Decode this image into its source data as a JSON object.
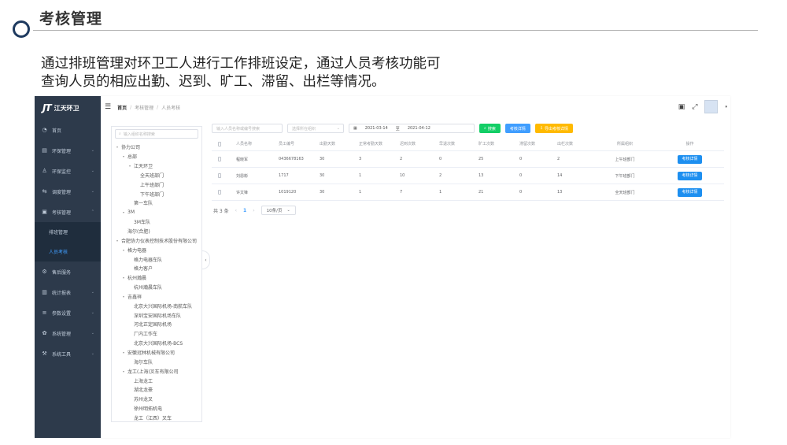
{
  "slide": {
    "title": "考核管理",
    "description_line1": "通过排班管理对环卫工人进行工作排班设定，通过人员考核功能可",
    "description_line2": "查询人员的相应出勤、迟到、旷工、滞留、出栏等情况。"
  },
  "app": {
    "logo_mark": "JT",
    "logo_text": "江天环卫",
    "breadcrumb": {
      "home": "首页",
      "level1": "考核管理",
      "level2": "人员考核"
    },
    "sidebar": {
      "items": [
        {
          "label": "首页",
          "icon": "dashboard-icon"
        },
        {
          "label": "环保管理",
          "icon": "folder-icon"
        },
        {
          "label": "环保监控",
          "icon": "monitor-icon"
        },
        {
          "label": "调度管理",
          "icon": "dispatch-icon"
        },
        {
          "label": "考核管理",
          "icon": "assessment-icon"
        }
      ],
      "sub_items": [
        {
          "label": "排班管理",
          "active": false
        },
        {
          "label": "人员考核",
          "active": true
        }
      ],
      "items_after": [
        {
          "label": "售后服务",
          "icon": "service-icon"
        },
        {
          "label": "统计报表",
          "icon": "report-icon"
        },
        {
          "label": "参数设置",
          "icon": "list-icon"
        },
        {
          "label": "系统管理",
          "icon": "gear-icon"
        },
        {
          "label": "系统工具",
          "icon": "tools-icon"
        }
      ]
    },
    "tree": {
      "search_placeholder": "输入组织名称搜索",
      "nodes": [
        {
          "label": "协力公司",
          "depth": 0,
          "caret": true
        },
        {
          "label": "总部",
          "depth": 1,
          "caret": true
        },
        {
          "label": "江天环卫",
          "depth": 2,
          "caret": true
        },
        {
          "label": "全天班部门",
          "depth": 3,
          "caret": false
        },
        {
          "label": "上午班部门",
          "depth": 3,
          "caret": false
        },
        {
          "label": "下午班部门",
          "depth": 3,
          "caret": false
        },
        {
          "label": "第一车队",
          "depth": 2,
          "caret": false
        },
        {
          "label": "3M",
          "depth": 1,
          "caret": true
        },
        {
          "label": "3M车队",
          "depth": 2,
          "caret": false
        },
        {
          "label": "海尔(合肥)",
          "depth": 1,
          "caret": false
        },
        {
          "label": "合肥协力仪表控制技术股份有限公司",
          "depth": 0,
          "caret": true
        },
        {
          "label": "格力电器",
          "depth": 1,
          "caret": true
        },
        {
          "label": "格力电器车队",
          "depth": 2,
          "caret": false
        },
        {
          "label": "格力客户",
          "depth": 2,
          "caret": false
        },
        {
          "label": "杭州瀚晨",
          "depth": 1,
          "caret": true
        },
        {
          "label": "杭州瀚晨车队",
          "depth": 2,
          "caret": false
        },
        {
          "label": "吉鑫祥",
          "depth": 1,
          "caret": true
        },
        {
          "label": "北京大兴国际机场-南航车队",
          "depth": 2,
          "caret": false
        },
        {
          "label": "深圳宝安国际机场车队",
          "depth": 2,
          "caret": false
        },
        {
          "label": "河北正定国际机场",
          "depth": 2,
          "caret": false
        },
        {
          "label": "厂内工作车",
          "depth": 2,
          "caret": false
        },
        {
          "label": "北京大兴国际机场-BCS",
          "depth": 2,
          "caret": false
        },
        {
          "label": "安徽冠林机械有限公司",
          "depth": 1,
          "caret": true
        },
        {
          "label": "海尔车队",
          "depth": 2,
          "caret": false
        },
        {
          "label": "龙工(上海)叉车有限公司",
          "depth": 1,
          "caret": true
        },
        {
          "label": "上海龙工",
          "depth": 2,
          "caret": false
        },
        {
          "label": "湖北龙豪",
          "depth": 2,
          "caret": false
        },
        {
          "label": "苏州龙叉",
          "depth": 2,
          "caret": false
        },
        {
          "label": "徐州明拓机电",
          "depth": 2,
          "caret": false
        },
        {
          "label": "龙工（江西）叉车",
          "depth": 2,
          "caret": false
        }
      ]
    },
    "filters": {
      "name_placeholder": "输入人员名称或编号搜索",
      "org_placeholder": "选择所在组织",
      "date_start": "2021-03-14",
      "date_sep": "至",
      "date_end": "2021-04-12",
      "search_btn": "搜索",
      "detail_btn": "考核详情",
      "export_btn": "导出考核详情"
    },
    "table": {
      "columns": [
        "人员名称",
        "员工编号",
        "出勤天数",
        "正常考勤天数",
        "迟到次数",
        "早退次数",
        "旷工次数",
        "滞留次数",
        "出栏次数",
        "所属组织",
        "操作"
      ],
      "rows": [
        [
          "程晓军",
          "0436678163",
          "30",
          "3",
          "2",
          "0",
          "25",
          "0",
          "2",
          "上午班部门"
        ],
        [
          "刘恩彬",
          "1717",
          "30",
          "1",
          "10",
          "2",
          "13",
          "0",
          "14",
          "下午班部门"
        ],
        [
          "许文锋",
          "1019120",
          "30",
          "1",
          "7",
          "1",
          "21",
          "0",
          "13",
          "全天班部门"
        ]
      ],
      "action_label": "考核详情"
    },
    "pager": {
      "total": "共 3 条",
      "prev": "‹",
      "page": "1",
      "next": "›",
      "page_size": "10条/页"
    }
  }
}
